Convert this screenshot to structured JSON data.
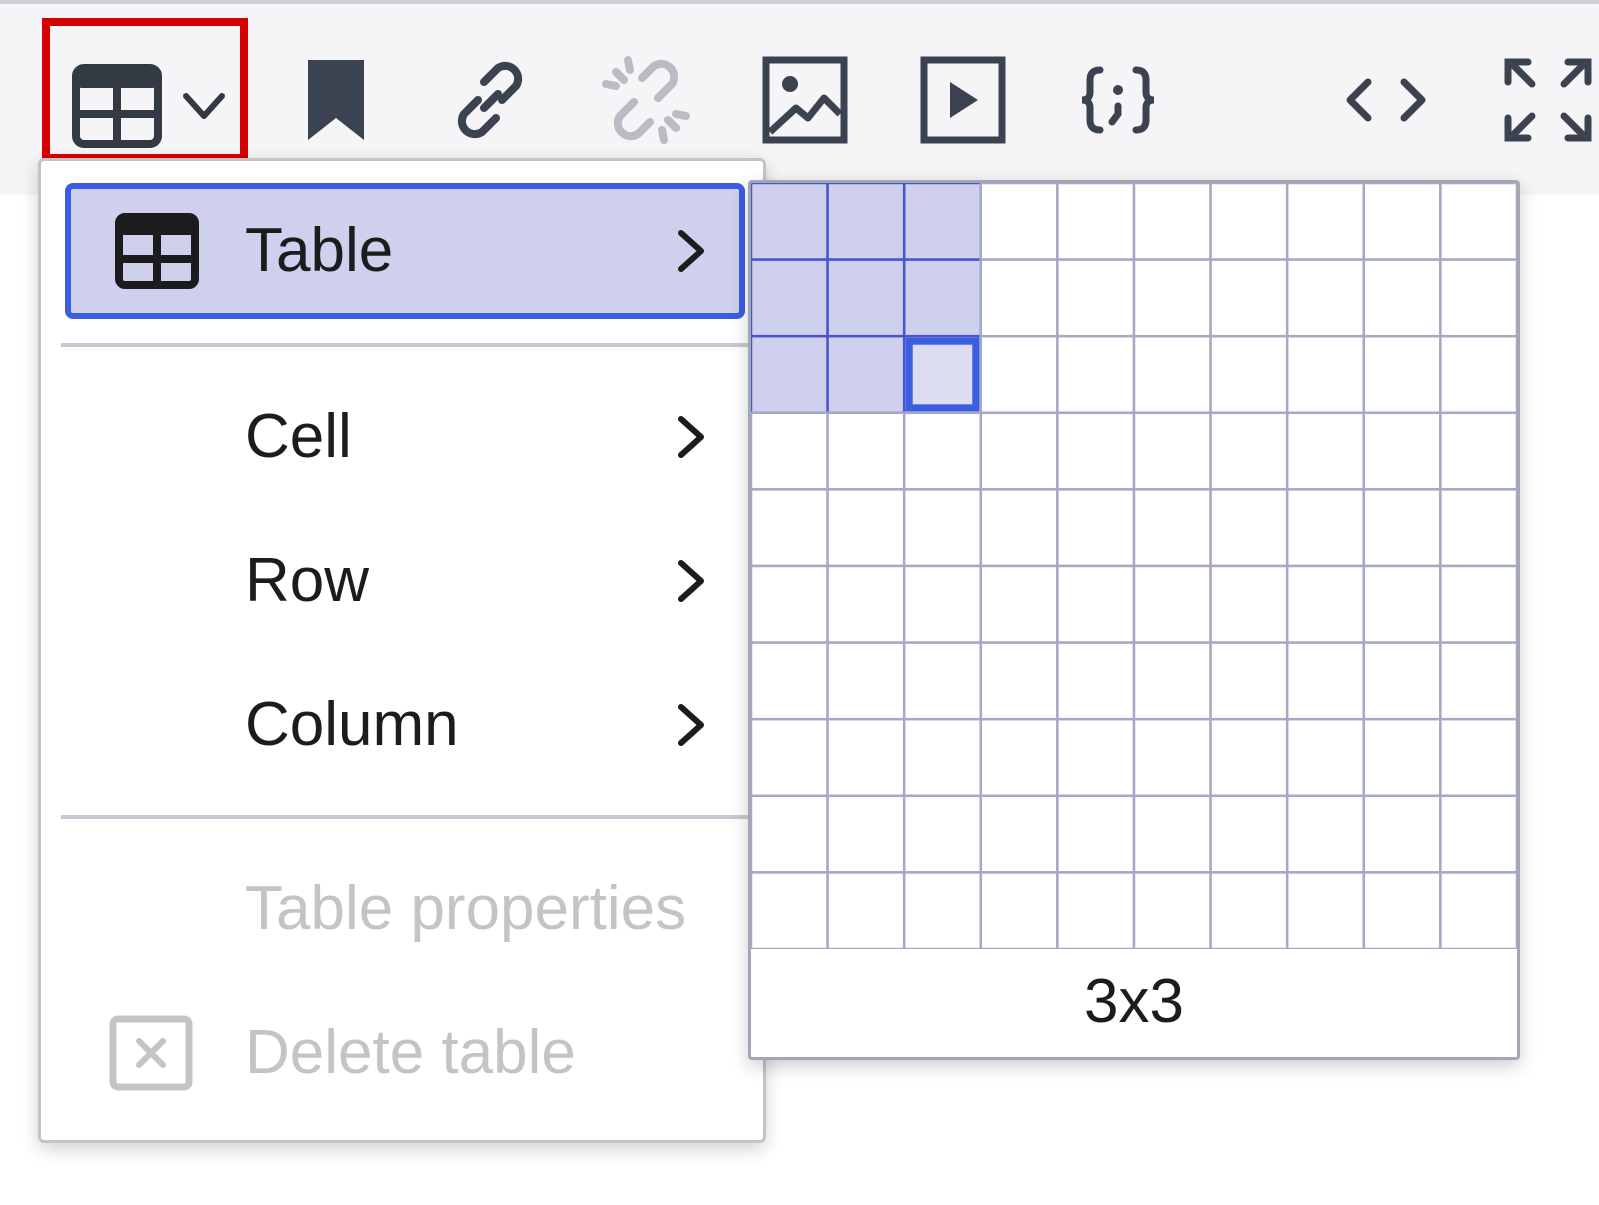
{
  "toolbar": {
    "buttons": [
      {
        "name": "table-dropdown-button",
        "icon": "table-grid-icon",
        "highlighted": true
      },
      {
        "name": "bookmark-button",
        "icon": "bookmark-icon"
      },
      {
        "name": "link-button",
        "icon": "link-icon"
      },
      {
        "name": "unlink-button",
        "icon": "unlink-icon",
        "disabled": true
      },
      {
        "name": "image-button",
        "icon": "image-icon"
      },
      {
        "name": "media-button",
        "icon": "play-icon"
      },
      {
        "name": "code-sample-button",
        "icon": "code-sample-icon"
      },
      {
        "name": "source-code-button",
        "icon": "source-code-icon"
      },
      {
        "name": "fullscreen-button",
        "icon": "fullscreen-icon"
      }
    ],
    "highlight_color": "#d40000"
  },
  "menu": {
    "items": [
      {
        "label": "Table",
        "icon": "table-grid-icon",
        "submenu": true,
        "active": true
      },
      {
        "label": "Cell",
        "submenu": true
      },
      {
        "label": "Row",
        "submenu": true
      },
      {
        "label": "Column",
        "submenu": true
      },
      {
        "label": "Table properties",
        "disabled": true
      },
      {
        "label": "Delete table",
        "icon": "delete-table-icon",
        "disabled": true
      }
    ],
    "active_bg": "#cfcfee",
    "active_border": "#3b5de0",
    "disabled_color": "#c4c4c4"
  },
  "picker": {
    "columns": 10,
    "rows": 10,
    "selected_columns": 3,
    "selected_rows": 3,
    "size_label": "3x3",
    "selected_fill": "#cfcfee",
    "selected_line": "#4a55cc",
    "grid_line": "#a6a9c4"
  }
}
